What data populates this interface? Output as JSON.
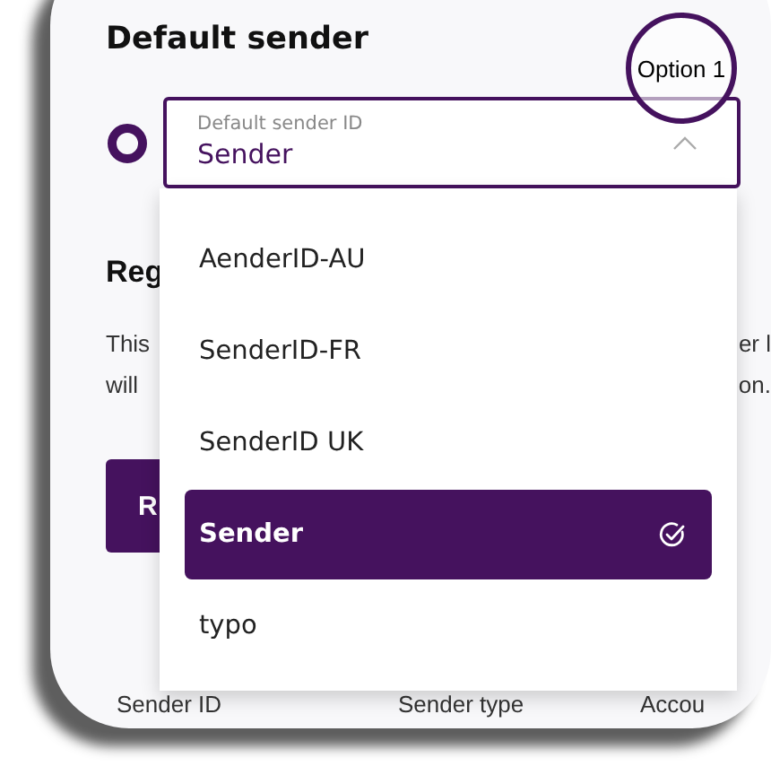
{
  "section_title": "Default sender",
  "annotation": "Option 1",
  "radio": {
    "selected": true
  },
  "select": {
    "label": "Default sender ID",
    "value": "Sender",
    "expanded": true
  },
  "options": [
    {
      "label": "AenderID-AU",
      "selected": false
    },
    {
      "label": "SenderID-FR",
      "selected": false
    },
    {
      "label": "SenderID UK",
      "selected": false
    },
    {
      "label": "Sender",
      "selected": true
    },
    {
      "label": "typo",
      "selected": false
    }
  ],
  "background": {
    "heading": "Reg",
    "paragraph_lines": [
      {
        "left": "This",
        "right": "er l"
      },
      {
        "left": "will",
        "right": "on."
      }
    ],
    "button": "R",
    "table_columns": [
      "Sender ID",
      "Sender type",
      "Accou"
    ]
  }
}
